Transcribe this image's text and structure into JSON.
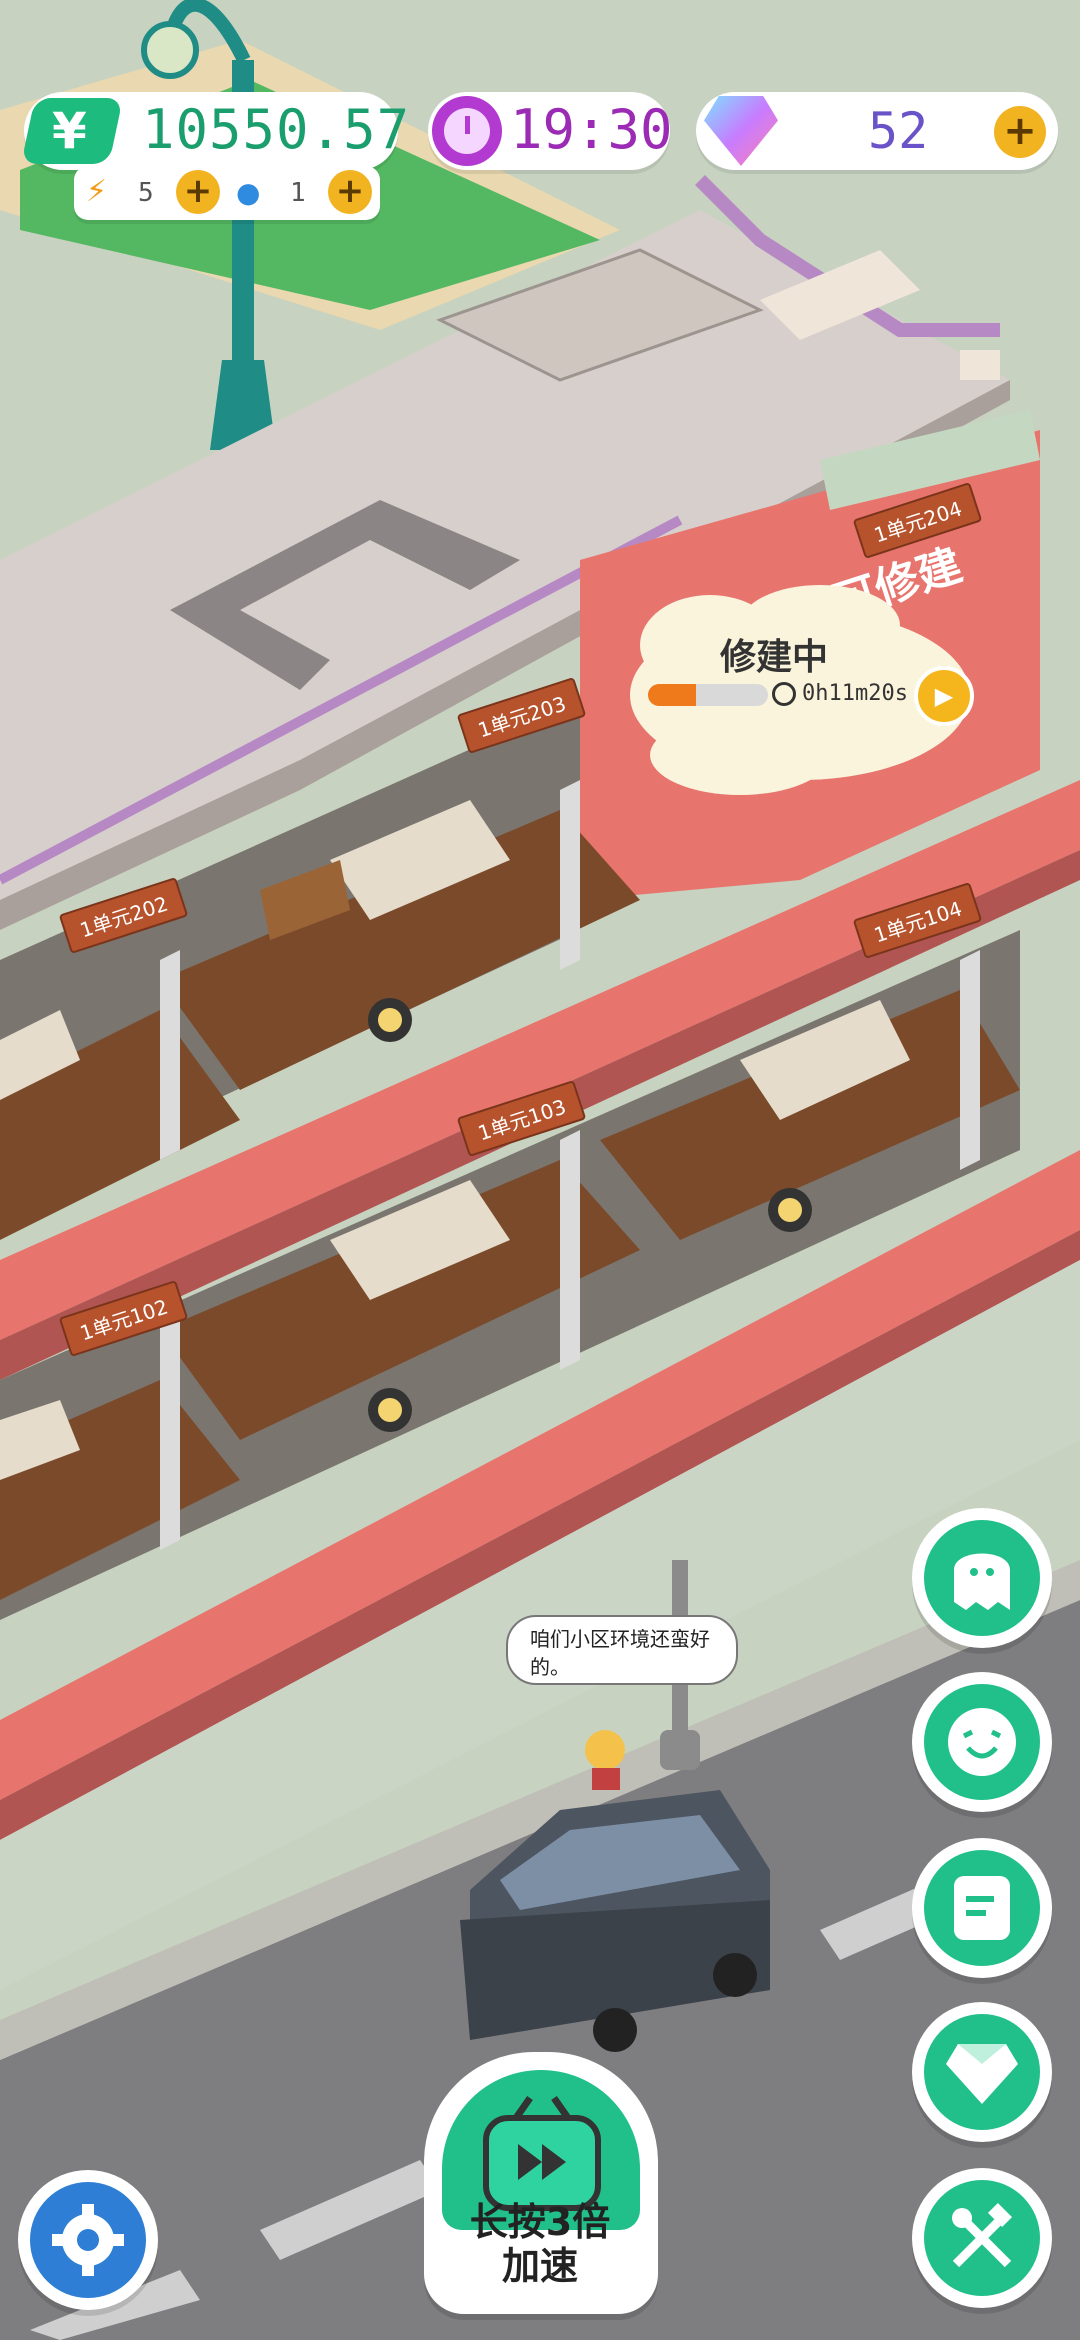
{
  "hud": {
    "money": "10550.57",
    "energy_count": "5",
    "water_count": "1",
    "time": "19:30",
    "gems": "52"
  },
  "building": {
    "rooms": [
      "1单元203",
      "1单元202",
      "1单元103",
      "1单元102",
      "1单元104",
      "1单元204"
    ],
    "locked_sign": "可修建",
    "construction": {
      "title": "修建中",
      "timer": "0h11m20s",
      "progress": 0.4
    }
  },
  "character": {
    "speech": "咱们小区环境还蛮好的。"
  },
  "speed_button": {
    "label_line1": "长按3倍",
    "label_line2": "加速"
  },
  "side_menu": [
    "ghost-icon",
    "smile-icon",
    "notes-icon",
    "gem-icon",
    "tools-icon"
  ],
  "colors": {
    "accent": "#21c08b",
    "money": "#1a9e6e",
    "time": "#9b2ab5",
    "wall_red": "#e8746e"
  }
}
